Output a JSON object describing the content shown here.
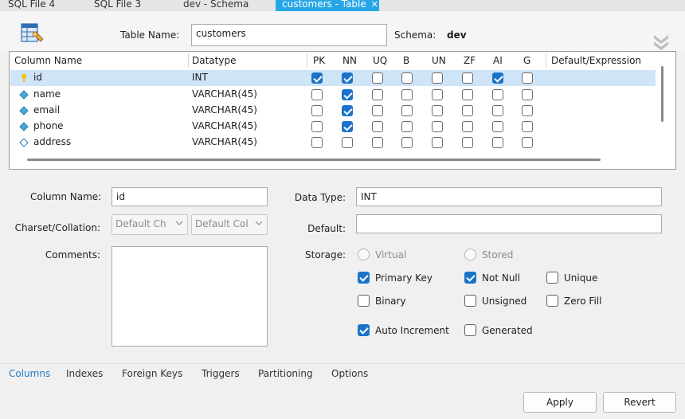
{
  "tabs": [
    {
      "label": "SQL File 4",
      "active": false
    },
    {
      "label": "SQL File 3",
      "active": false
    },
    {
      "label": "dev - Schema",
      "active": false
    },
    {
      "label": "customers - Table",
      "active": true
    }
  ],
  "header": {
    "table_name_label": "Table Name:",
    "table_name_value": "customers",
    "schema_label": "Schema:",
    "schema_value": "dev"
  },
  "grid": {
    "columns": [
      "Column Name",
      "Datatype",
      "PK",
      "NN",
      "UQ",
      "B",
      "UN",
      "ZF",
      "AI",
      "G",
      "Default/Expression"
    ],
    "rows": [
      {
        "name": "id",
        "type": "INT",
        "icon": "primary-key-icon",
        "flags": [
          true,
          true,
          false,
          false,
          false,
          false,
          true,
          false
        ],
        "default": "",
        "selected": true
      },
      {
        "name": "name",
        "type": "VARCHAR(45)",
        "icon": "column-diamond-icon",
        "flags": [
          false,
          true,
          false,
          false,
          false,
          false,
          false,
          false
        ],
        "default": "",
        "selected": false
      },
      {
        "name": "email",
        "type": "VARCHAR(45)",
        "icon": "column-diamond-icon",
        "flags": [
          false,
          true,
          false,
          false,
          false,
          false,
          false,
          false
        ],
        "default": "",
        "selected": false
      },
      {
        "name": "phone",
        "type": "VARCHAR(45)",
        "icon": "column-diamond-icon",
        "flags": [
          false,
          true,
          false,
          false,
          false,
          false,
          false,
          false
        ],
        "default": "",
        "selected": false
      },
      {
        "name": "address",
        "type": "VARCHAR(45)",
        "icon": "column-diamond-outline-icon",
        "flags": [
          false,
          false,
          false,
          false,
          false,
          false,
          false,
          false
        ],
        "default": "",
        "selected": false
      }
    ]
  },
  "details": {
    "column_name_label": "Column Name:",
    "column_name_value": "id",
    "charset_label": "Charset/Collation:",
    "charset_value": "Default Ch",
    "collation_value": "Default Col",
    "comments_label": "Comments:",
    "data_type_label": "Data Type:",
    "data_type_value": "INT",
    "default_label": "Default:",
    "default_value": "",
    "storage_label": "Storage:",
    "virtual_label": "Virtual",
    "stored_label": "Stored",
    "options": [
      {
        "label": "Primary Key",
        "checked": true
      },
      {
        "label": "Not Null",
        "checked": true
      },
      {
        "label": "Unique",
        "checked": false
      },
      {
        "label": "Binary",
        "checked": false
      },
      {
        "label": "Unsigned",
        "checked": false
      },
      {
        "label": "Zero Fill",
        "checked": false
      },
      {
        "label": "Auto Increment",
        "checked": true
      },
      {
        "label": "Generated",
        "checked": false
      }
    ]
  },
  "bottom_tabs": [
    {
      "label": "Columns",
      "active": true
    },
    {
      "label": "Indexes",
      "active": false
    },
    {
      "label": "Foreign Keys",
      "active": false
    },
    {
      "label": "Triggers",
      "active": false
    },
    {
      "label": "Partitioning",
      "active": false
    },
    {
      "label": "Options",
      "active": false
    }
  ],
  "buttons": {
    "apply": "Apply",
    "revert": "Revert"
  },
  "colors": {
    "accent": "#27a7e7",
    "check": "#1a73c8",
    "selection": "#cfe4f7"
  }
}
